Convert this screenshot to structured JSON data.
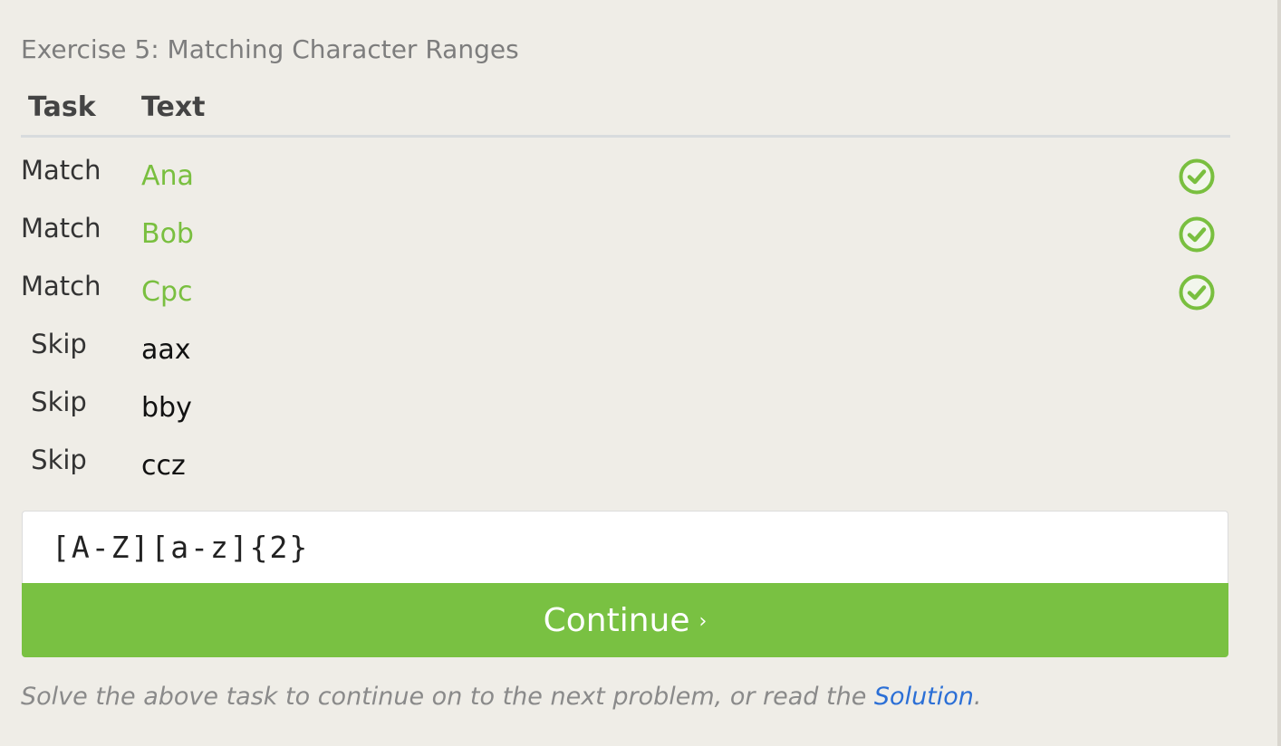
{
  "exercise": {
    "title": "Exercise 5: Matching Character Ranges"
  },
  "table": {
    "headers": {
      "task": "Task",
      "text": "Text"
    },
    "rows": [
      {
        "task": "Match",
        "text": "Ana",
        "status": "passed"
      },
      {
        "task": "Match",
        "text": "Bob",
        "status": "passed"
      },
      {
        "task": "Match",
        "text": "Cpc",
        "status": "passed"
      },
      {
        "task": "Skip",
        "text": "aax",
        "status": "none"
      },
      {
        "task": "Skip",
        "text": "bby",
        "status": "none"
      },
      {
        "task": "Skip",
        "text": "ccz",
        "status": "none"
      }
    ]
  },
  "input": {
    "value": "[A-Z][a-z]{2}",
    "placeholder": ""
  },
  "continue_button": {
    "label": "Continue",
    "chevron": "›"
  },
  "footer": {
    "prefix": "Solve the above task to continue on to the next problem, or read the ",
    "link_label": "Solution",
    "suffix": "."
  },
  "icons": {
    "check": "check-circle-icon"
  },
  "colors": {
    "background": "#efede7",
    "accent_green": "#79c142",
    "match_text_green": "#79bf3f",
    "link_blue": "#2b6fd6"
  }
}
